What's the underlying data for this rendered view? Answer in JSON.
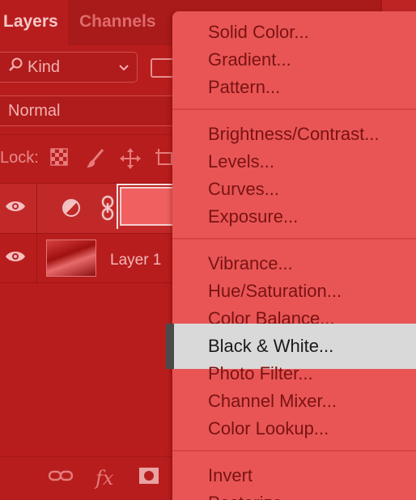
{
  "tabs": [
    {
      "label": "Layers",
      "active": true
    },
    {
      "label": "Channels",
      "active": false
    }
  ],
  "filter": {
    "kind_label": "Kind",
    "kind_icon": "search-icon",
    "chevron_icon": "chevron-down-icon"
  },
  "blend": {
    "mode": "Normal"
  },
  "lock": {
    "label": "Lock:"
  },
  "layers": [
    {
      "name": "",
      "type": "adjustment",
      "visible": true
    },
    {
      "name": "Layer 1",
      "type": "pixel",
      "visible": true
    }
  ],
  "menu": {
    "groups": [
      [
        "Solid Color...",
        "Gradient...",
        "Pattern..."
      ],
      [
        "Brightness/Contrast...",
        "Levels...",
        "Curves...",
        "Exposure..."
      ],
      [
        "Vibrance...",
        "Hue/Saturation...",
        "Color Balance...",
        "Black & White...",
        "Photo Filter...",
        "Channel Mixer...",
        "Color Lookup..."
      ],
      [
        "Invert",
        "Posterize..."
      ]
    ],
    "highlighted": "Black & White..."
  },
  "colors": {
    "panel_bg": "#b81d1d",
    "menu_bg": "#e95555",
    "highlight_bg": "#d9d9d9"
  }
}
